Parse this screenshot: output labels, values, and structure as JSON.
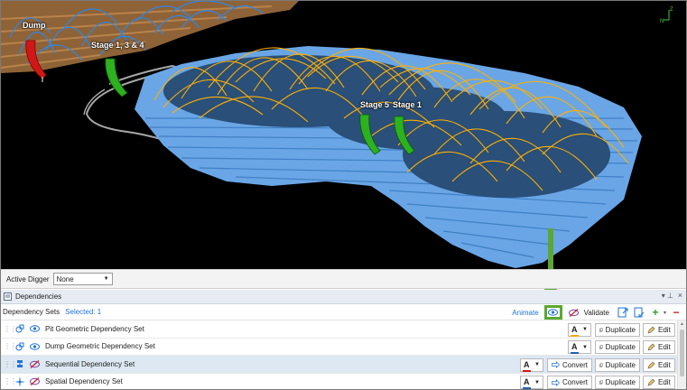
{
  "viewport": {
    "locations": [
      {
        "label": "Dump",
        "color": "#e01a1a"
      },
      {
        "label": "Stage 1, 3 & 4",
        "color": "#2db11f"
      },
      {
        "label": "Stage 5",
        "color": "#2db11f"
      },
      {
        "label": "Stage 1",
        "color": "#2db11f"
      }
    ],
    "axis": {
      "z": "Z",
      "n": "N"
    },
    "colors": {
      "pit": "#6aa6e6",
      "arcs": "#ffb000",
      "dump_arcs": "#2f86e8",
      "terrain": "#9b6a3b"
    }
  },
  "digger": {
    "label": "Active Digger",
    "value": "None"
  },
  "panel": {
    "title": "Dependencies",
    "sets_label": "Dependency Sets",
    "selected_label": "Selected: 1",
    "animate": "Animate",
    "validate": "Validate",
    "annotation_color": "#5aa830"
  },
  "rows": [
    {
      "name": "Pit Geometric Dependency Set",
      "icon": "geometric-icon",
      "visible": true,
      "line_color": "#f0a800",
      "duplicate": "Duplicate",
      "edit": "Edit"
    },
    {
      "name": "Dump Geometric Dependency Set",
      "icon": "geometric-icon",
      "visible": true,
      "line_color": "#1e5fb0",
      "duplicate": "Duplicate",
      "edit": "Edit"
    },
    {
      "name": "Sequential Dependency Set",
      "icon": "sequential-icon",
      "visible": false,
      "line_color": "#d01818",
      "convert": "Convert",
      "duplicate": "Duplicate",
      "edit": "Edit"
    },
    {
      "name": "Spatial Dependency Set",
      "icon": "spatial-icon",
      "visible": false,
      "line_color": "#1e5fb0",
      "convert": "Convert",
      "duplicate": "Duplicate",
      "edit": "Edit"
    }
  ]
}
